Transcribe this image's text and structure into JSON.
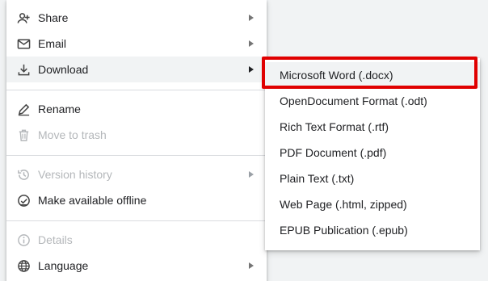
{
  "main_menu": {
    "items": [
      {
        "label": "Share",
        "icon": "share-person-add-icon",
        "submenu": true,
        "disabled": false
      },
      {
        "label": "Email",
        "icon": "email-icon",
        "submenu": true,
        "disabled": false
      },
      {
        "label": "Download",
        "icon": "download-icon",
        "submenu": true,
        "disabled": false,
        "active": true
      },
      {
        "label": "Rename",
        "icon": "rename-pen-icon",
        "submenu": false,
        "disabled": false
      },
      {
        "label": "Move to trash",
        "icon": "trash-icon",
        "submenu": false,
        "disabled": true
      },
      {
        "label": "Version history",
        "icon": "history-icon",
        "submenu": true,
        "disabled": true
      },
      {
        "label": "Make available offline",
        "icon": "offline-check-icon",
        "submenu": false,
        "disabled": false
      },
      {
        "label": "Details",
        "icon": "info-icon",
        "submenu": false,
        "disabled": true
      },
      {
        "label": "Language",
        "icon": "globe-icon",
        "submenu": true,
        "disabled": false
      }
    ]
  },
  "download_submenu": {
    "items": [
      {
        "label": "Microsoft Word (.docx)",
        "highlighted": true
      },
      {
        "label": "OpenDocument Format (.odt)"
      },
      {
        "label": "Rich Text Format (.rtf)"
      },
      {
        "label": "PDF Document (.pdf)"
      },
      {
        "label": "Plain Text (.txt)"
      },
      {
        "label": "Web Page (.html, zipped)"
      },
      {
        "label": "EPUB Publication (.epub)"
      }
    ]
  },
  "colors": {
    "highlight_border": "#e00000",
    "text": "#202124",
    "disabled_text": "#b4b7ba",
    "hover_background": "#f1f3f4"
  }
}
